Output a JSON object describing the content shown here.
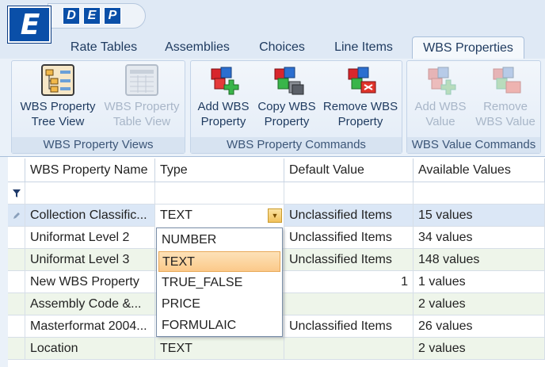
{
  "app": {
    "logo_letter": "E",
    "qat_buttons": [
      "D",
      "E",
      "P"
    ]
  },
  "tabs": [
    {
      "label": "Rate Tables",
      "active": false
    },
    {
      "label": "Assemblies",
      "active": false
    },
    {
      "label": "Choices",
      "active": false
    },
    {
      "label": "Line Items",
      "active": false
    },
    {
      "label": "WBS Properties",
      "active": true
    }
  ],
  "ribbon": {
    "groups": [
      {
        "label": "WBS Property Views",
        "buttons": [
          {
            "label_1": "WBS Property",
            "label_2": "Tree View",
            "icon": "tree-view-icon",
            "enabled": true
          },
          {
            "label_1": "WBS Property",
            "label_2": "Table View",
            "icon": "table-view-icon",
            "enabled": false
          }
        ]
      },
      {
        "label": "WBS Property Commands",
        "buttons": [
          {
            "label_1": "Add WBS",
            "label_2": "Property",
            "icon": "add-cubes-icon",
            "enabled": true
          },
          {
            "label_1": "Copy WBS",
            "label_2": "Property",
            "icon": "copy-cubes-icon",
            "enabled": true
          },
          {
            "label_1": "Remove WBS",
            "label_2": "Property",
            "icon": "remove-cubes-icon",
            "enabled": true
          }
        ]
      },
      {
        "label": "WBS Value Commands",
        "buttons": [
          {
            "label_1": "Add WBS",
            "label_2": "Value",
            "icon": "add-value-icon",
            "enabled": false
          },
          {
            "label_1": "Remove",
            "label_2": "WBS Value",
            "icon": "remove-value-icon",
            "enabled": false
          }
        ]
      }
    ]
  },
  "grid": {
    "columns": [
      "WBS Property Name",
      "Type",
      "Default Value",
      "Available Values"
    ],
    "rows": [
      {
        "name": "Collection Classific...",
        "type": "TEXT",
        "default": "Unclassified Items",
        "available": "15 values",
        "editing": true
      },
      {
        "name": "Uniformat Level 2",
        "type": "",
        "default": "Unclassified Items",
        "available": "34 values"
      },
      {
        "name": "Uniformat Level 3",
        "type": "",
        "default": "Unclassified Items",
        "available": "148 values"
      },
      {
        "name": "New WBS Property",
        "type": "",
        "default": "1",
        "available": "1 values"
      },
      {
        "name": "Assembly Code &...",
        "type": "",
        "default": "",
        "available": "2 values"
      },
      {
        "name": "Masterformat 2004...",
        "type": "",
        "default": "Unclassified Items",
        "available": "26 values"
      },
      {
        "name": "Location",
        "type": "TEXT",
        "default": "",
        "available": "2 values"
      }
    ]
  },
  "dropdown": {
    "options": [
      "NUMBER",
      "TEXT",
      "TRUE_FALSE",
      "PRICE",
      "FORMULAIC"
    ],
    "selected": "TEXT"
  },
  "colors": {
    "accent": "#0a4fa8",
    "row_alt": "#eef5ea",
    "row_selected": "#dbe7f6",
    "highlight": "#fbc98a"
  }
}
